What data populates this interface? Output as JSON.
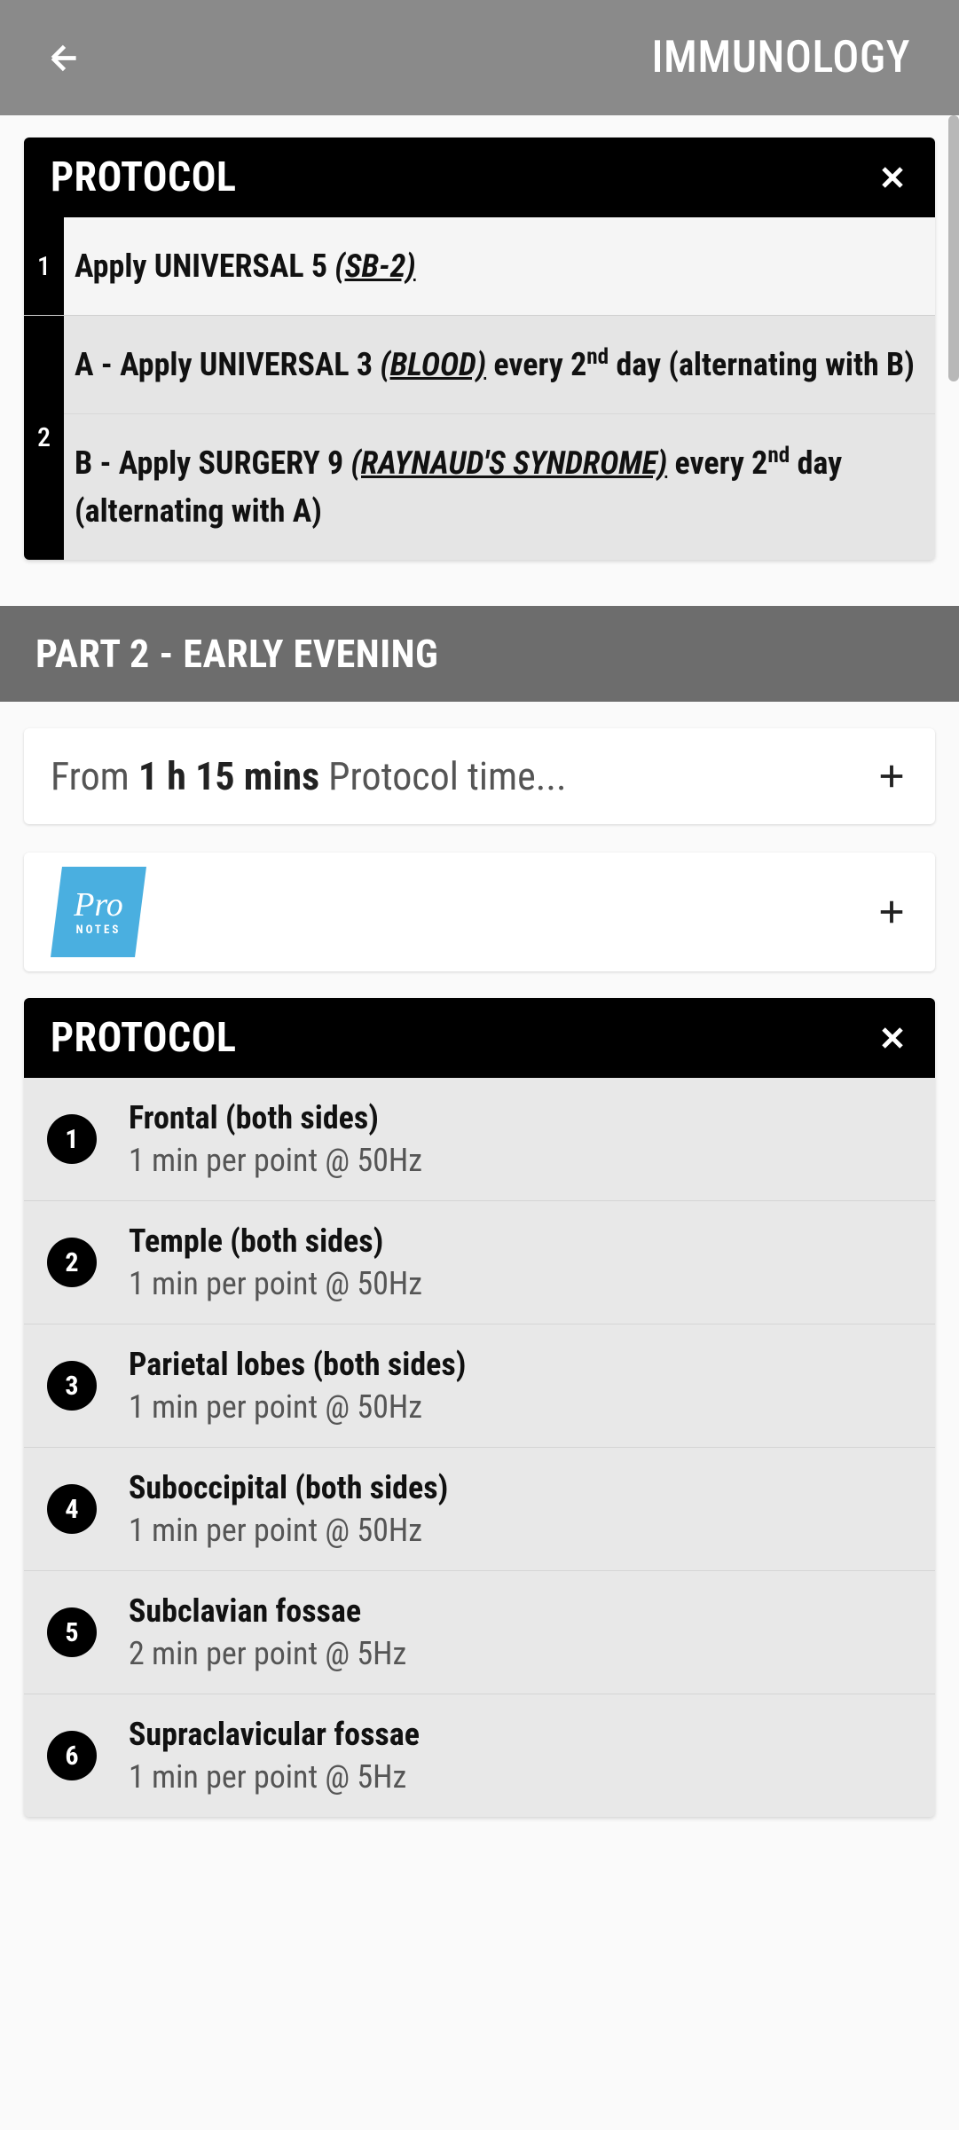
{
  "header": {
    "title": "IMMUNOLOGY"
  },
  "protocol1": {
    "title": "PROTOCOL",
    "rows": [
      {
        "num": "1",
        "lines": [
          {
            "prefix": "Apply UNIVERSAL 5 ",
            "ul": "(SB-2)",
            "suffix": ""
          }
        ]
      },
      {
        "num": "2",
        "lines": [
          {
            "prefix": "A - Apply UNIVERSAL 3 ",
            "ul": "(BLOOD)",
            "suffix_before_sup": " every 2",
            "sup": "nd",
            "suffix": " day (alternating with B)"
          },
          {
            "prefix": "B - Apply SURGERY 9 ",
            "ul": "(RAYNAUD'S SYNDROME)",
            "suffix_before_sup": " every 2",
            "sup": "nd",
            "suffix": " day (alternating with A)"
          }
        ]
      }
    ]
  },
  "section2": {
    "title": "PART 2 - EARLY EVENING"
  },
  "expand": {
    "prefix": "From ",
    "bold": "1 h 15 mins",
    "suffix": " Protocol time..."
  },
  "pronotes": {
    "main": "Pro",
    "sub": "NOTES"
  },
  "protocol2": {
    "title": "PROTOCOL",
    "steps": [
      {
        "num": "1",
        "title": "Frontal (both sides)",
        "sub": "1 min per point @ 50Hz"
      },
      {
        "num": "2",
        "title": "Temple (both sides)",
        "sub": "1 min per point @ 50Hz"
      },
      {
        "num": "3",
        "title": "Parietal lobes (both sides)",
        "sub": "1 min per point @ 50Hz"
      },
      {
        "num": "4",
        "title": "Suboccipital (both sides)",
        "sub": "1 min per point @ 50Hz"
      },
      {
        "num": "5",
        "title": "Subclavian fossae",
        "sub": "2 min per point @ 5Hz"
      },
      {
        "num": "6",
        "title": "Supraclavicular fossae",
        "sub": "1 min per point @ 5Hz"
      }
    ]
  }
}
